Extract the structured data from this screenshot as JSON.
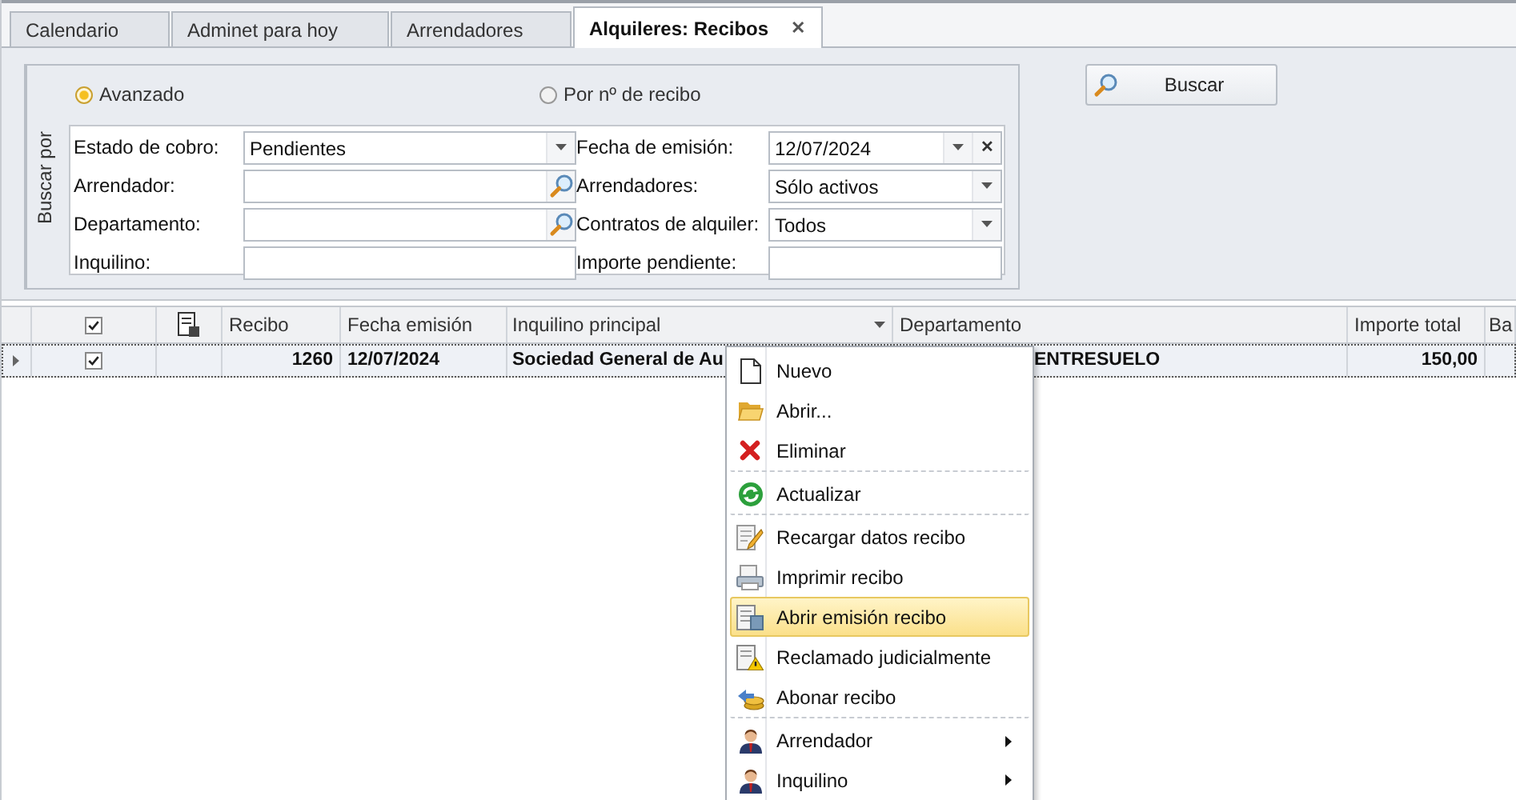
{
  "tabs": [
    {
      "label": "Calendario",
      "selected": false
    },
    {
      "label": "Adminet para hoy",
      "selected": false
    },
    {
      "label": "Arrendadores",
      "selected": false
    },
    {
      "label": "Alquileres: Recibos",
      "selected": true,
      "close_glyph": "✕"
    }
  ],
  "search_group": {
    "caption": "Buscar por",
    "modes": [
      {
        "label": "Avanzado",
        "selected": true
      },
      {
        "label": "Por nº de recibo",
        "selected": false
      }
    ],
    "fields": [
      {
        "label": "Estado de cobro:",
        "kind": "combo",
        "value": "Pendientes"
      },
      {
        "label": "Fecha de emisión:",
        "kind": "date",
        "value": "12/07/2024",
        "clear_glyph": "✕"
      },
      {
        "label": "Arrendador:",
        "kind": "lookup"
      },
      {
        "label": "Arrendadores:",
        "kind": "combo",
        "value": "Sólo activos"
      },
      {
        "label": "Departamento:",
        "kind": "lookup"
      },
      {
        "label": "Contratos de alquiler:",
        "kind": "combo",
        "value": "Todos"
      },
      {
        "label": "Inquilino:",
        "kind": "text"
      },
      {
        "label": "Importe pendiente:",
        "kind": "text"
      }
    ]
  },
  "search_button": {
    "label": "Buscar"
  },
  "table": {
    "header_checked": true,
    "columns": [
      "Recibo",
      "Fecha emisión",
      "Inquilino principal",
      "Departamento",
      "Importe total",
      "Ba"
    ],
    "rows": [
      {
        "checked": true,
        "selected": true,
        "recibo": "1260",
        "fecha": "12/07/2024",
        "inquilino": "Sociedad General de Au",
        "departamento": "ENTRESUELO",
        "importe": "150,00"
      }
    ]
  },
  "context_menu": [
    {
      "label": "Nuevo",
      "kind": "page",
      "separator": false,
      "submenu": false,
      "selected": false
    },
    {
      "label": "Abrir...",
      "kind": "folder",
      "separator": false,
      "submenu": false,
      "selected": false
    },
    {
      "label": "Eliminar",
      "kind": "cross",
      "separator": false,
      "submenu": false,
      "selected": false
    },
    {
      "label": "Actualizar",
      "kind": "refresh",
      "separator": true,
      "submenu": false,
      "selected": false
    },
    {
      "label": "Recargar datos recibo",
      "kind": "edit",
      "separator": true,
      "submenu": false,
      "selected": false
    },
    {
      "label": "Imprimir recibo",
      "kind": "print",
      "separator": false,
      "submenu": false,
      "selected": false
    },
    {
      "label": "Abrir emisión recibo",
      "kind": "doc",
      "separator": false,
      "submenu": false,
      "selected": true
    },
    {
      "label": "Reclamado judicialmente",
      "kind": "warn",
      "separator": false,
      "submenu": false,
      "selected": false
    },
    {
      "label": "Abonar recibo",
      "kind": "coins",
      "separator": false,
      "submenu": false,
      "selected": false
    },
    {
      "label": "Arrendador",
      "kind": "person",
      "separator": true,
      "submenu": true,
      "selected": false
    },
    {
      "label": "Inquilino",
      "kind": "person",
      "separator": false,
      "submenu": true,
      "selected": false
    }
  ]
}
